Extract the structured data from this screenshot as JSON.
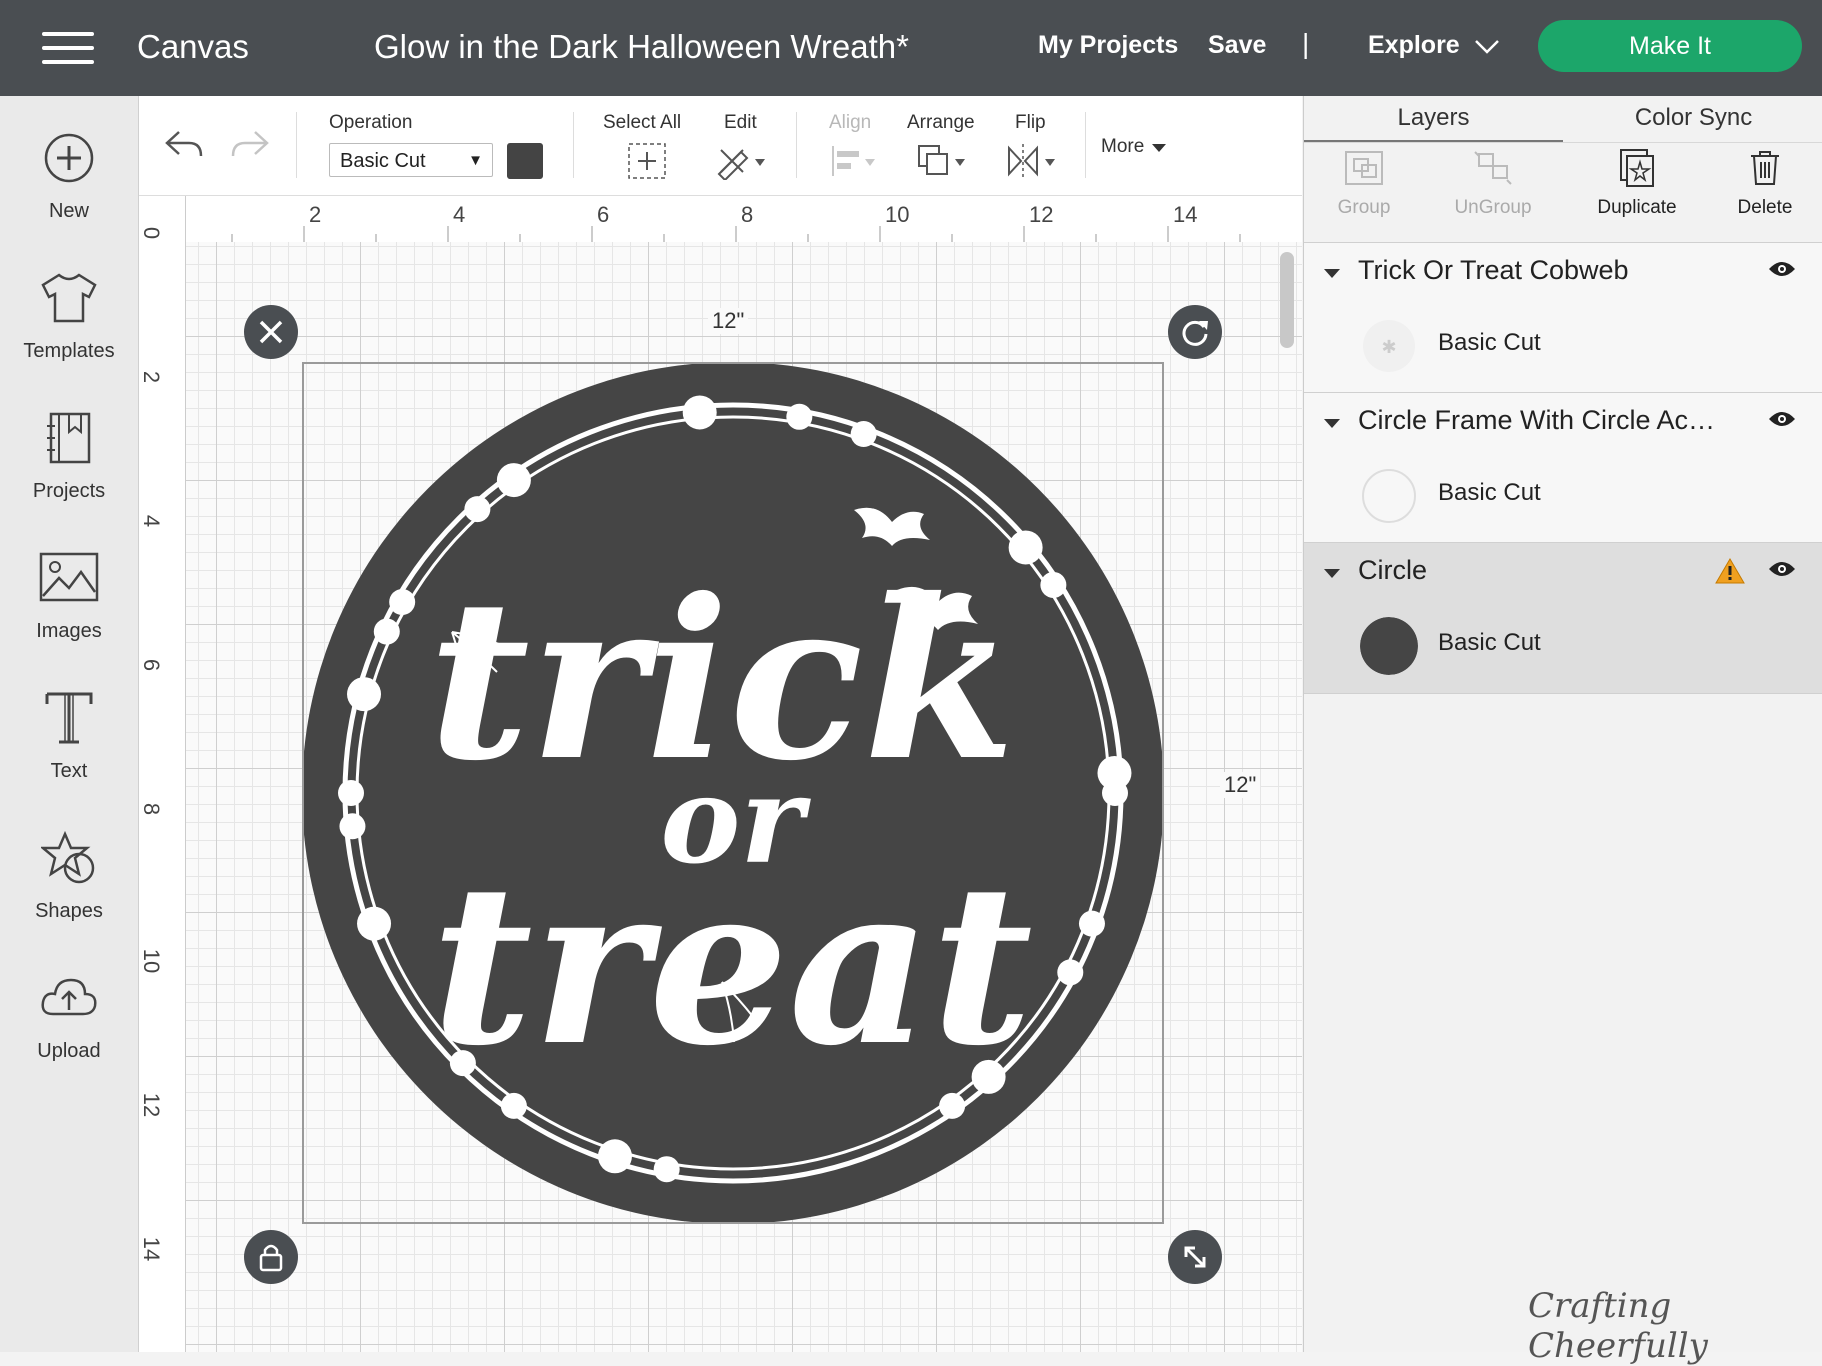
{
  "topbar": {
    "app_name": "Canvas",
    "doc_title": "Glow in the Dark Halloween Wreath*",
    "my_projects": "My Projects",
    "save": "Save",
    "separator": "|",
    "explore": "Explore",
    "make_it": "Make It"
  },
  "sidebar": {
    "items": [
      {
        "label": "New",
        "icon": "plus-circle-icon"
      },
      {
        "label": "Templates",
        "icon": "tshirt-icon"
      },
      {
        "label": "Projects",
        "icon": "bookmark-book-icon"
      },
      {
        "label": "Images",
        "icon": "image-icon"
      },
      {
        "label": "Text",
        "icon": "text-t-icon"
      },
      {
        "label": "Shapes",
        "icon": "shapes-icon"
      },
      {
        "label": "Upload",
        "icon": "cloud-upload-icon"
      }
    ]
  },
  "toolbar": {
    "operation_label": "Operation",
    "operation_value": "Basic Cut",
    "operation_color": "#444444",
    "select_all": "Select All",
    "edit": "Edit",
    "align": "Align",
    "arrange": "Arrange",
    "flip": "Flip",
    "more": "More"
  },
  "ruler": {
    "top": [
      "2",
      "4",
      "6",
      "8",
      "10",
      "12",
      "14"
    ],
    "left": [
      "0",
      "2",
      "4",
      "6",
      "8",
      "10",
      "12",
      "14"
    ]
  },
  "canvas": {
    "width_label": "12\"",
    "height_label": "12\"",
    "design_color": "#454545",
    "design_text": [
      "trick",
      "or",
      "treat"
    ]
  },
  "panel": {
    "tabs": [
      "Layers",
      "Color Sync"
    ],
    "actions": {
      "group": "Group",
      "ungroup": "UnGroup",
      "duplicate": "Duplicate",
      "delete": "Delete"
    },
    "layers": [
      {
        "name": "Trick Or Treat Cobweb",
        "operation": "Basic Cut",
        "selected": false,
        "warning": false
      },
      {
        "name": "Circle Frame With Circle Ac…",
        "operation": "Basic Cut",
        "selected": false,
        "warning": false
      },
      {
        "name": "Circle",
        "operation": "Basic Cut",
        "selected": true,
        "warning": true
      }
    ]
  },
  "watermark": "Crafting Cheerfully",
  "colors": {
    "topbar": "#4a4e52",
    "make_it": "#1ca66a",
    "warning": "#f0a020"
  }
}
